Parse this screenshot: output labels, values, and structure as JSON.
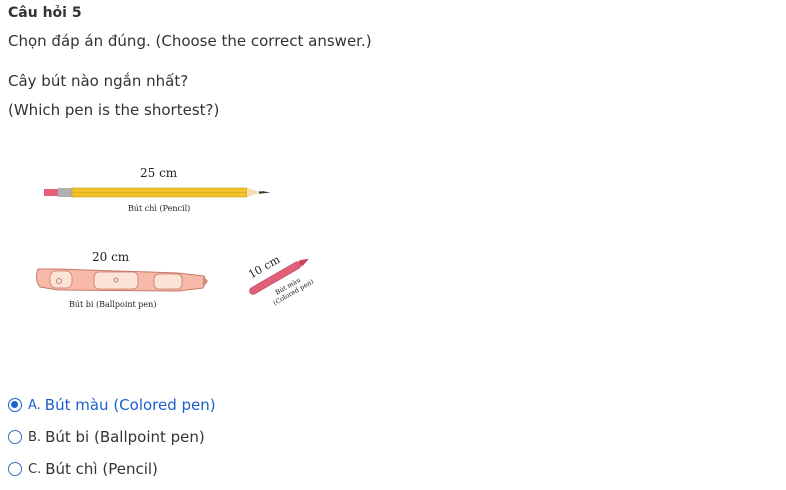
{
  "question": {
    "number_label": "Câu hỏi 5",
    "instruction": "Chọn đáp án đúng. (Choose the correct answer.)",
    "text_vi": "Cây bút nào ngắn nhất?",
    "text_en": "(Which pen is the shortest?)"
  },
  "figure": {
    "pencil_length": "25 cm",
    "pencil_caption": "Bút chì (Pencil)",
    "ballpoint_length": "20 cm",
    "ballpoint_caption": "Bút bi (Ballpoint pen)",
    "colored_length": "10 cm",
    "colored_caption_line1": "Bút màu",
    "colored_caption_line2": "(Colored pen)"
  },
  "options": [
    {
      "letter": "A.",
      "text": "Bút màu (Colored pen)",
      "selected": true
    },
    {
      "letter": "B.",
      "text": "Bút bi (Ballpoint pen)",
      "selected": false
    },
    {
      "letter": "C.",
      "text": "Bút chì (Pencil)",
      "selected": false
    }
  ],
  "colors": {
    "selected": "#1a5fd0",
    "radio_border": "#3e6fb5",
    "pencil_body": "#f2c12e",
    "ballpoint_body": "#f7b9a8",
    "colored_pen": "#e0607a"
  }
}
